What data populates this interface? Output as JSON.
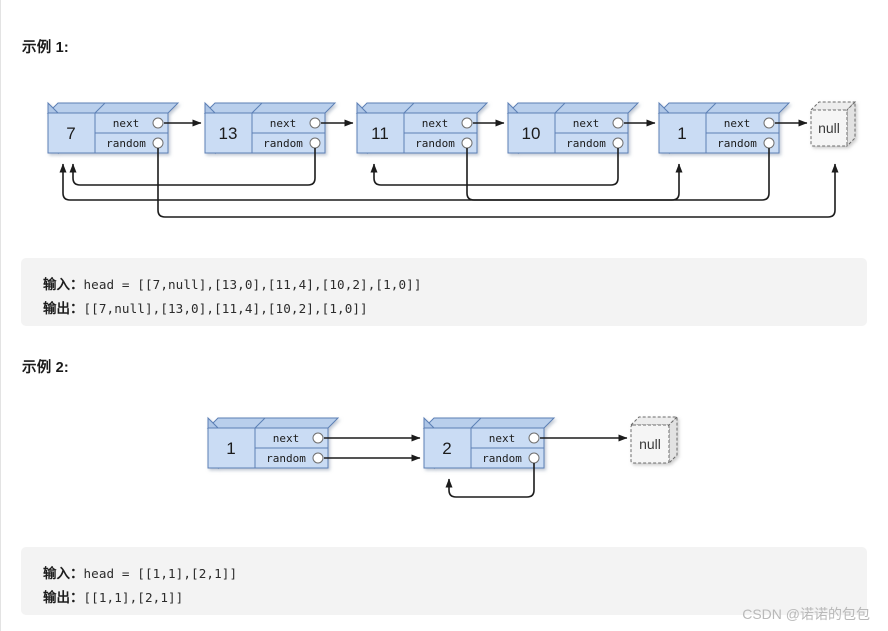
{
  "page": {
    "background": "#ffffff",
    "watermark": "CSDN @诺诺的包包"
  },
  "sections": [
    {
      "heading": "示例 1:",
      "code": {
        "input_label": "输入：",
        "input_value": "head = [[7,null],[13,0],[11,4],[10,2],[1,0]]",
        "output_label": "输出：",
        "output_value": "[[7,null],[13,0],[11,4],[10,2],[1,0]]"
      },
      "diagram": {
        "node_fill": "#c5d8f1",
        "node_face": "#cfe0f5",
        "node_stroke": "#5b7fb5",
        "null_fill": "#f5f5f5",
        "null_stroke": "#6b6b6b",
        "arrow_color": "#1c1c1c",
        "field_next": "next",
        "field_random": "random",
        "null_label": "null",
        "nodes": [
          {
            "value": "7",
            "next": "13",
            "random": "null"
          },
          {
            "value": "13",
            "next": "11",
            "random": "7"
          },
          {
            "value": "11",
            "next": "10",
            "random": "1"
          },
          {
            "value": "10",
            "next": "1",
            "random": "11"
          },
          {
            "value": "1",
            "next": "null",
            "random": "7"
          }
        ]
      }
    },
    {
      "heading": "示例 2:",
      "code": {
        "input_label": "输入：",
        "input_value": "head = [[1,1],[2,1]]",
        "output_label": "输出：",
        "output_value": "[[1,1],[2,1]]"
      },
      "diagram": {
        "field_next": "next",
        "field_random": "random",
        "null_label": "null",
        "nodes": [
          {
            "value": "1",
            "next": "2",
            "random": "2"
          },
          {
            "value": "2",
            "next": "null",
            "random": "2"
          }
        ]
      }
    }
  ]
}
